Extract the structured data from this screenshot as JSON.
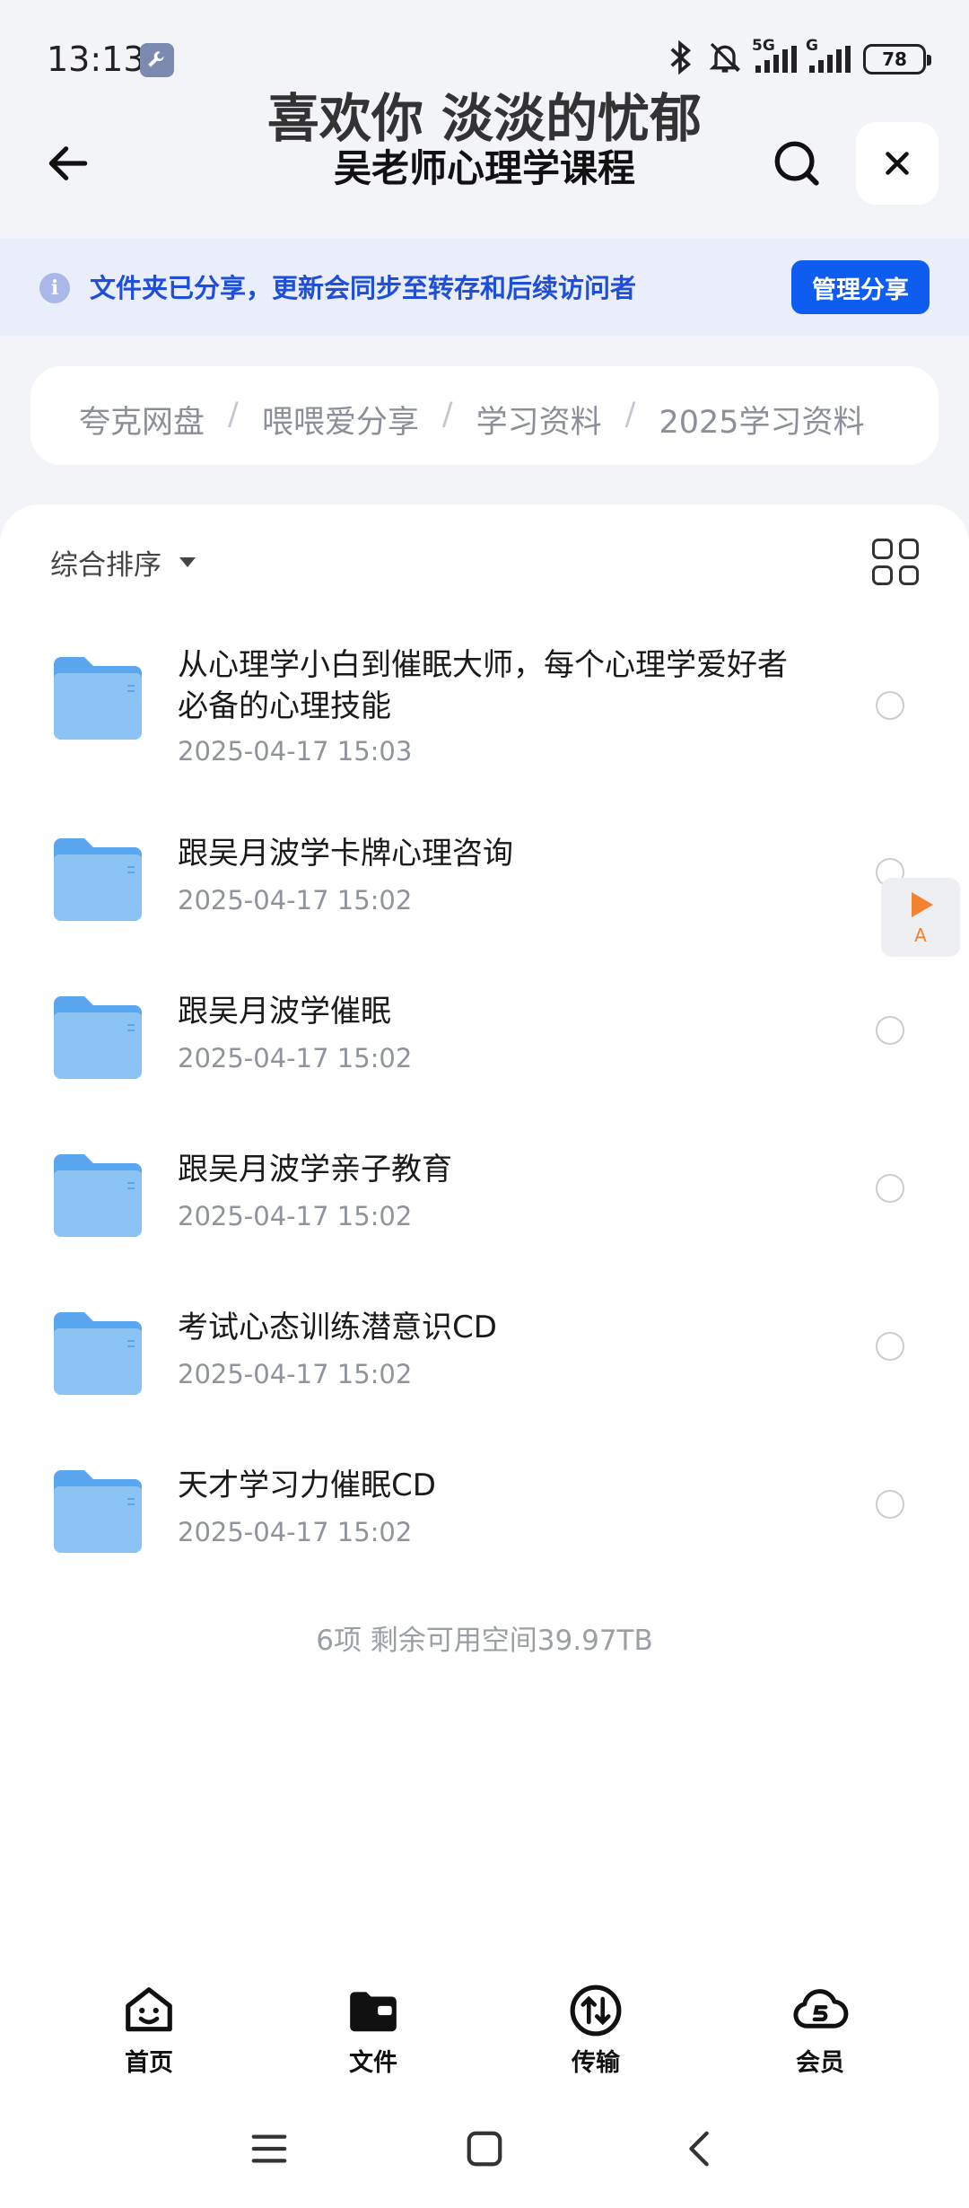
{
  "status_bar": {
    "time": "13:13",
    "network_5g": "5G",
    "network_g": "G",
    "battery": "78",
    "icons": [
      "wrench-icon",
      "bluetooth-icon",
      "bell-muted-icon",
      "signal-icon",
      "battery-icon"
    ]
  },
  "header": {
    "title_main": "喜欢你 淡淡的忧郁",
    "title_sub": "吴老师心理学课程"
  },
  "notice": {
    "text": "文件夹已分享，更新会同步至转存和后续访问者",
    "manage_label": "管理分享"
  },
  "breadcrumb": {
    "items": [
      "夸克网盘",
      "喂喂爱分享",
      "学习资料",
      "2025学习资料"
    ]
  },
  "toolbar": {
    "sort_label": "综合排序"
  },
  "files": [
    {
      "name": "从心理学小白到催眠大师，每个心理学爱好者必备的心理技能",
      "date": "2025-04-17 15:03"
    },
    {
      "name": "跟吴月波学卡牌心理咨询",
      "date": "2025-04-17 15:02"
    },
    {
      "name": "跟吴月波学催眠",
      "date": "2025-04-17 15:02"
    },
    {
      "name": "跟吴月波学亲子教育",
      "date": "2025-04-17 15:02"
    },
    {
      "name": "考试心态训练潜意识CD",
      "date": "2025-04-17 15:02"
    },
    {
      "name": "天才学习力催眠CD",
      "date": "2025-04-17 15:02"
    }
  ],
  "summary": "6项 剩余可用空间39.97TB",
  "floating": {
    "letter": "A"
  },
  "bottom_nav": [
    {
      "label": "首页",
      "icon": "home-face-icon"
    },
    {
      "label": "文件",
      "icon": "folder-wallet-icon"
    },
    {
      "label": "传输",
      "icon": "transfer-icon"
    },
    {
      "label": "会员",
      "icon": "cloud-member-icon"
    }
  ],
  "colors": {
    "accent": "#0f5cf0",
    "notice_bg": "#e9eefa",
    "folder": "#5aa7ef"
  }
}
